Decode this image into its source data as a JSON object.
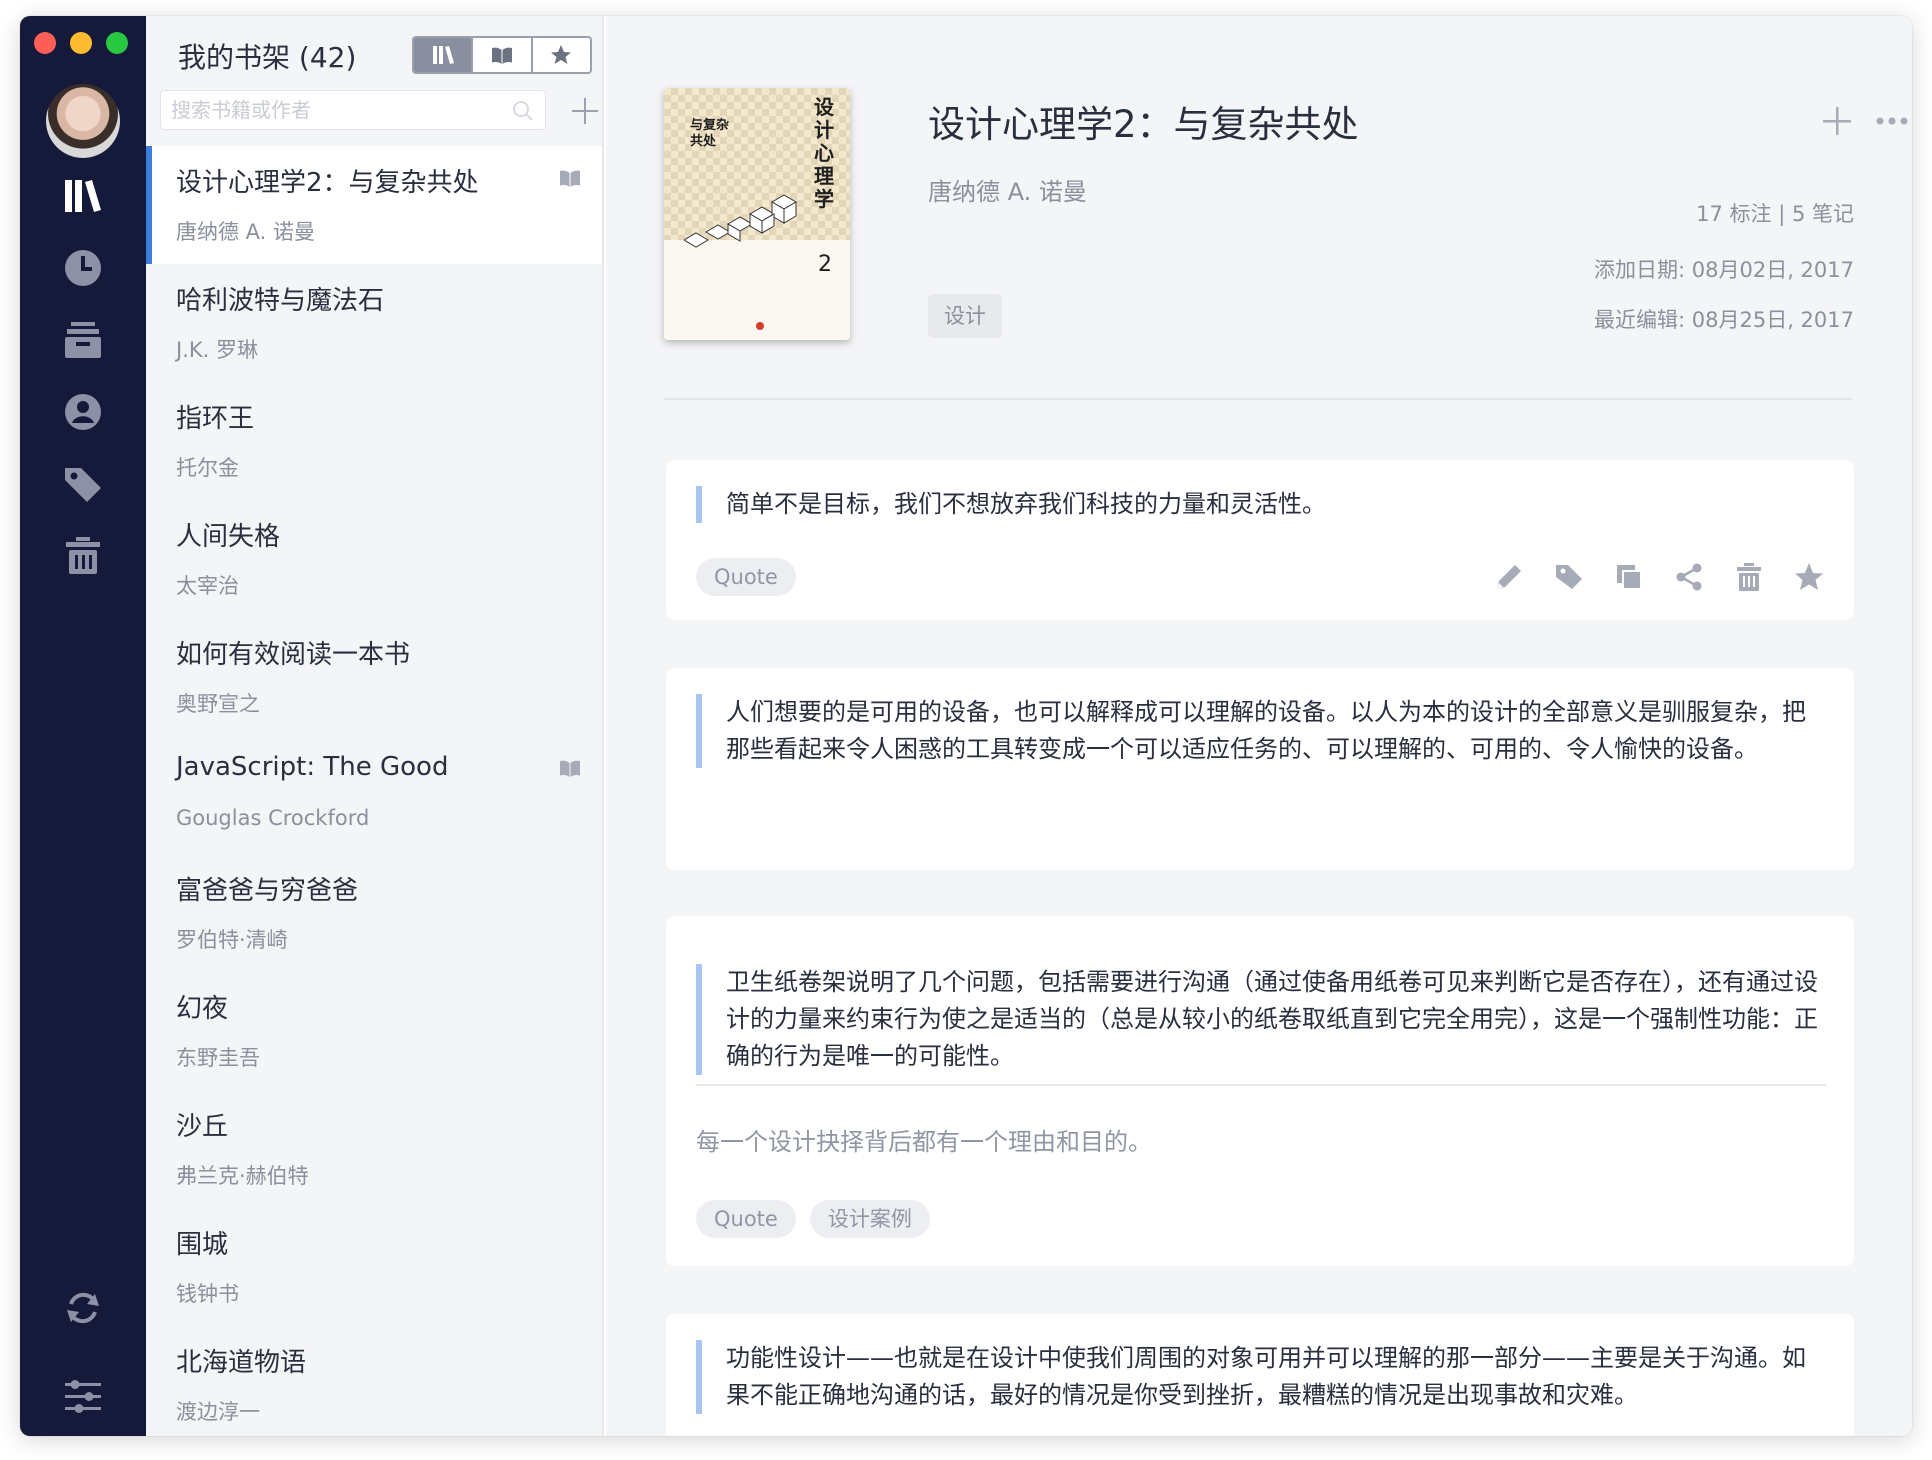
{
  "rail": {
    "icons": [
      "library-icon",
      "history-icon",
      "archive-icon",
      "profile-icon",
      "tag-icon",
      "trash-icon",
      "sync-icon",
      "settings-sliders-icon"
    ]
  },
  "list": {
    "title": "我的书架 (42)",
    "search_placeholder": "搜索书籍或作者",
    "books": [
      {
        "title": "设计心理学2：与复杂共处",
        "author": "唐纳德 A. 诺曼",
        "flag": true,
        "active": true
      },
      {
        "title": "哈利波特与魔法石",
        "author": "J.K. 罗琳",
        "flag": false
      },
      {
        "title": "指环王",
        "author": "托尔金",
        "flag": false
      },
      {
        "title": "人间失格",
        "author": "太宰治",
        "flag": false
      },
      {
        "title": "如何有效阅读一本书",
        "author": "奥野宣之",
        "flag": false
      },
      {
        "title": "JavaScript: The Good",
        "author": "Gouglas Crockford",
        "flag": true
      },
      {
        "title": "富爸爸与穷爸爸",
        "author": "罗伯特·清崎",
        "flag": false
      },
      {
        "title": "幻夜",
        "author": "东野圭吾",
        "flag": false
      },
      {
        "title": "沙丘",
        "author": "弗兰克·赫伯特",
        "flag": false
      },
      {
        "title": "围城",
        "author": "钱钟书",
        "flag": false
      },
      {
        "title": "北海道物语",
        "author": "渡边淳一",
        "flag": false
      }
    ]
  },
  "detail": {
    "cover": {
      "vertical_title": "设计心理学",
      "subtitle": "与复杂共处",
      "number": "2"
    },
    "title": "设计心理学2：与复杂共处",
    "author": "唐纳德 A. 诺曼",
    "tag": "设计",
    "counts": "17 标注 | 5 笔记",
    "added": "添加日期: 08月02日, 2017",
    "edited": "最近编辑: 08月25日, 2017"
  },
  "notes": [
    {
      "text": "简单不是目标，我们不想放弃我们科技的力量和灵活性。",
      "tags": [
        "Quote"
      ]
    },
    {
      "text": "人们想要的是可用的设备，也可以解释成可以理解的设备。以人为本的设计的全部意义是驯服复杂，把那些看起来令人困惑的工具转变成一个可以适应任务的、可以理解的、可用的、令人愉快的设备。",
      "tags": []
    },
    {
      "text": "卫生纸卷架说明了几个问题，包括需要进行沟通（通过使备用纸卷可见来判断它是否存在），还有通过设计的力量来约束行为使之是适当的（总是从较小的纸卷取纸直到它完全用完），这是一个强制性功能：正确的行为是唯一的可能性。",
      "comment": "每一个设计抉择背后都有一个理由和目的。",
      "tags": [
        "Quote",
        "设计案例"
      ]
    },
    {
      "text": "功能性设计——也就是在设计中使我们周围的对象可用并可以理解的那一部分——主要是关于沟通。如果不能正确地沟通的话，最好的情况是你受到挫折，最糟糕的情况是出现事故和灾难。",
      "tags": []
    }
  ],
  "colors": {
    "rail": "#151a3a",
    "accent": "#3b7ddd",
    "quote_bar": "#a9c6f0"
  }
}
